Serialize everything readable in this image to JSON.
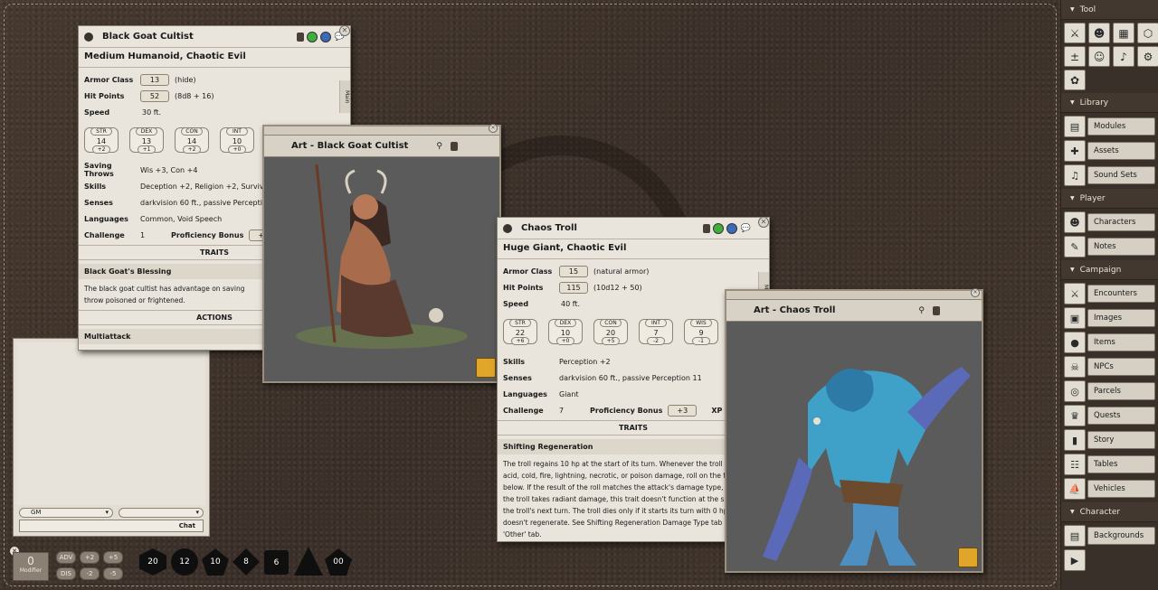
{
  "sidebar": {
    "tool_header": "Tool",
    "library_header": "Library",
    "library_items": [
      {
        "label": "Modules",
        "icon": "book-icon"
      },
      {
        "label": "Assets",
        "icon": "puzzle-icon"
      },
      {
        "label": "Sound Sets",
        "icon": "music-icon"
      }
    ],
    "player_header": "Player",
    "player_items": [
      {
        "label": "Characters",
        "icon": "characters-icon"
      },
      {
        "label": "Notes",
        "icon": "notes-icon"
      }
    ],
    "campaign_header": "Campaign",
    "campaign_items": [
      {
        "label": "Encounters",
        "icon": "swords-icon"
      },
      {
        "label": "Images",
        "icon": "images-icon"
      },
      {
        "label": "Items",
        "icon": "bag-icon"
      },
      {
        "label": "NPCs",
        "icon": "skull-icon"
      },
      {
        "label": "Parcels",
        "icon": "coins-icon"
      },
      {
        "label": "Quests",
        "icon": "trophy-icon"
      },
      {
        "label": "Story",
        "icon": "story-icon"
      },
      {
        "label": "Tables",
        "icon": "tables-icon"
      },
      {
        "label": "Vehicles",
        "icon": "ship-icon"
      }
    ],
    "character_header": "Character",
    "character_items": [
      {
        "label": "Backgrounds",
        "icon": "backgrounds-icon"
      }
    ]
  },
  "cultist": {
    "title": "Black Goat Cultist",
    "subtitle": "Medium Humanoid, Chaotic Evil",
    "side_tab": "Main",
    "ac_label": "Armor Class",
    "ac": "13",
    "ac_note": "(hide)",
    "hp_label": "Hit Points",
    "hp": "52",
    "hp_note": "(8d8 + 16)",
    "speed_label": "Speed",
    "speed": "30 ft.",
    "abilities": [
      {
        "name": "STR",
        "val": "14",
        "mod": "+2"
      },
      {
        "name": "DEX",
        "val": "13",
        "mod": "+1"
      },
      {
        "name": "CON",
        "val": "14",
        "mod": "+2"
      },
      {
        "name": "INT",
        "val": "10",
        "mod": "+0"
      }
    ],
    "saves_label": "Saving Throws",
    "saves": "Wis +3, Con +4",
    "skills_label": "Skills",
    "skills": "Deception +2, Religion +2, Survival +",
    "senses_label": "Senses",
    "senses": "darkvision 60 ft., passive Perception",
    "languages_label": "Languages",
    "languages": "Common, Void Speech",
    "challenge_label": "Challenge",
    "challenge": "1",
    "prof_label": "Proficiency Bonus",
    "prof": "+2",
    "traits_header": "TRAITS",
    "trait_name": "Black Goat's Blessing",
    "trait_text": "The black goat cultist has advantage on saving throw poisoned or frightened.",
    "actions_header": "ACTIONS",
    "action_name": "Multiattack"
  },
  "cultist_art": {
    "title": "Art - Black Goat Cultist"
  },
  "troll": {
    "title": "Chaos Troll",
    "subtitle": "Huge Giant, Chaotic Evil",
    "side_tab": "Ma",
    "ac_label": "Armor Class",
    "ac": "15",
    "ac_note": "(natural armor)",
    "hp_label": "Hit Points",
    "hp": "115",
    "hp_note": "(10d12 + 50)",
    "speed_label": "Speed",
    "speed": "40 ft.",
    "abilities": [
      {
        "name": "STR",
        "val": "22",
        "mod": "+6"
      },
      {
        "name": "DEX",
        "val": "10",
        "mod": "+0"
      },
      {
        "name": "CON",
        "val": "20",
        "mod": "+5"
      },
      {
        "name": "INT",
        "val": "7",
        "mod": "-2"
      },
      {
        "name": "WIS",
        "val": "9",
        "mod": "-1"
      }
    ],
    "skills_label": "Skills",
    "skills": "Perception +2",
    "senses_label": "Senses",
    "senses": "darkvision 60 ft., passive Perception 11",
    "languages_label": "Languages",
    "languages": "Giant",
    "challenge_label": "Challenge",
    "challenge": "7",
    "prof_label": "Proficiency Bonus",
    "prof": "+3",
    "xp_label": "XP",
    "traits_header": "TRAITS",
    "trait_name": "Shifting Regeneration",
    "trait_lines": [
      "The troll regains 10 hp at the start of its turn. Whenever the troll",
      "acid, cold, fire, lightning, necrotic, or poison damage, roll on the t",
      "below. If the result of the roll matches the attack's damage type,",
      "the troll takes radiant damage, this trait doesn't function at the s",
      "the troll's next turn. The troll dies only if it starts its turn with 0 hp",
      "doesn't regenerate. See Shifting Regeneration Damage Type tab",
      "'Other' tab."
    ]
  },
  "troll_art": {
    "title": "Art - Chaos Troll"
  },
  "chat": {
    "identity": "GM",
    "button": "Chat"
  },
  "bottom": {
    "modifier_value": "0",
    "modifier_label": "Modifier",
    "adv": "ADV",
    "dis": "DIS",
    "m1": "+2",
    "m2": "+5",
    "m3": "-2",
    "m4": "-5",
    "dice": [
      "20",
      "12",
      "10",
      "8",
      "6",
      "4",
      "00"
    ]
  }
}
